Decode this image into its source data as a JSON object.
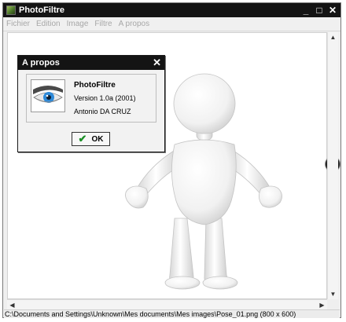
{
  "window": {
    "title": "PhotoFiltre",
    "controls": {
      "minimize": "_",
      "maximize": "□",
      "close": "✕"
    }
  },
  "menu": [
    "Fichier",
    "Edition",
    "Image",
    "Filtre",
    "A propos"
  ],
  "about_dialog": {
    "title": "A propos",
    "close_glyph": "✕",
    "app_name": "PhotoFiltre",
    "version": "Version 1.0a (2001)",
    "author": "Antonio DA CRUZ",
    "ok_label": "OK",
    "ok_icon": "✔"
  },
  "canvas": {
    "image_subject": "3d-figure-icon",
    "next_arrow": "›"
  },
  "statusbar": {
    "text": "C:\\Documents and Settings\\Unknown\\Mes documents\\Mes images\\Pose_01.png (800 x 600)"
  },
  "colors": {
    "titlebar": "#141414",
    "ok_check": "#1b8f26",
    "eye_iris": "#2f8ad8"
  }
}
